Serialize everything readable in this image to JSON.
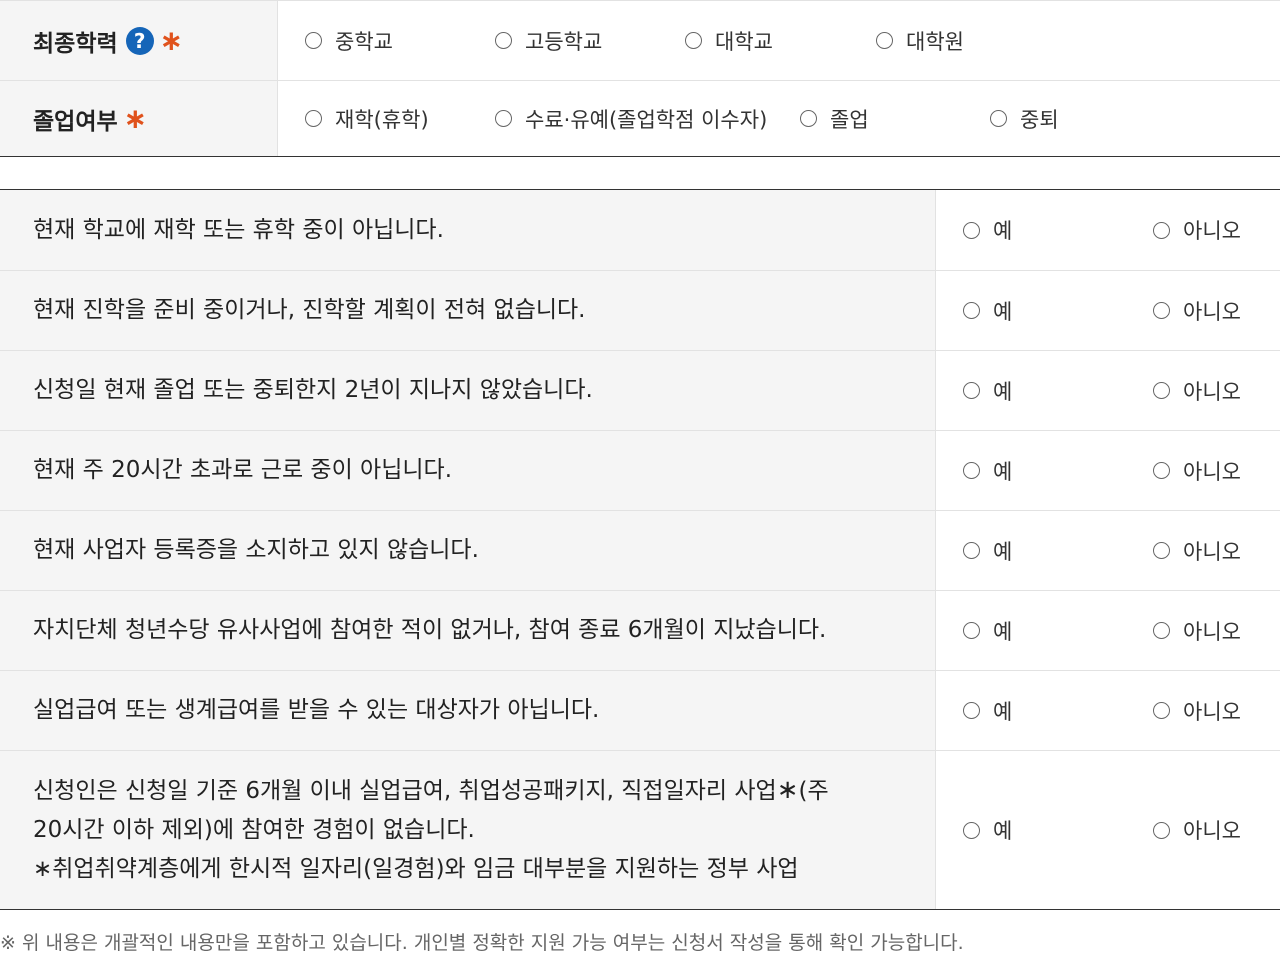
{
  "education": {
    "label": "최종학력",
    "help_icon": "question-circle-icon",
    "required_mark": "∗",
    "options": [
      "중학교",
      "고등학교",
      "대학교",
      "대학원"
    ]
  },
  "graduation": {
    "label": "졸업여부",
    "required_mark": "∗",
    "options": [
      "재학(휴학)",
      "수료·유예(졸업학점 이수자)",
      "졸업",
      "중퇴"
    ]
  },
  "checklist": {
    "yes_label": "예",
    "no_label": "아니오",
    "questions": [
      "현재 학교에 재학 또는 휴학 중이 아닙니다.",
      "현재 진학을 준비 중이거나, 진학할 계획이 전혀 없습니다.",
      "신청일 현재 졸업 또는 중퇴한지 2년이 지나지 않았습니다.",
      "현재 주 20시간 초과로 근로 중이 아닙니다.",
      "현재 사업자 등록증을 소지하고 있지 않습니다.",
      "자치단체 청년수당 유사사업에 참여한 적이 없거나, 참여 종료 6개월이 지났습니다.",
      "실업급여 또는 생계급여를 받을 수 있는 대상자가 아닙니다."
    ],
    "last_question": {
      "line1_a": "신청인은 신청일 기준 6개월 이내 실업급여, 취업성공패키지, 직접일자리 사업",
      "line1_star": "∗",
      "line1_b": "(주",
      "line2": "20시간 이하 제외)에 참여한 경험이 없습니다.",
      "line3": "∗취업취약계층에게 한시적 일자리(일경험)와 임금 대부분을 지원하는 정부 사업"
    }
  },
  "footnote": "※ 위 내용은 개괄적인 내용만을 포함하고 있습니다. 개인별 정확한 지원 가능 여부는 신청서 작성을 통해 확인 가능합니다.",
  "colors": {
    "accent_required": "#e0521c",
    "help_icon_bg": "#1565b8",
    "header_bg": "#f5f5f5"
  }
}
